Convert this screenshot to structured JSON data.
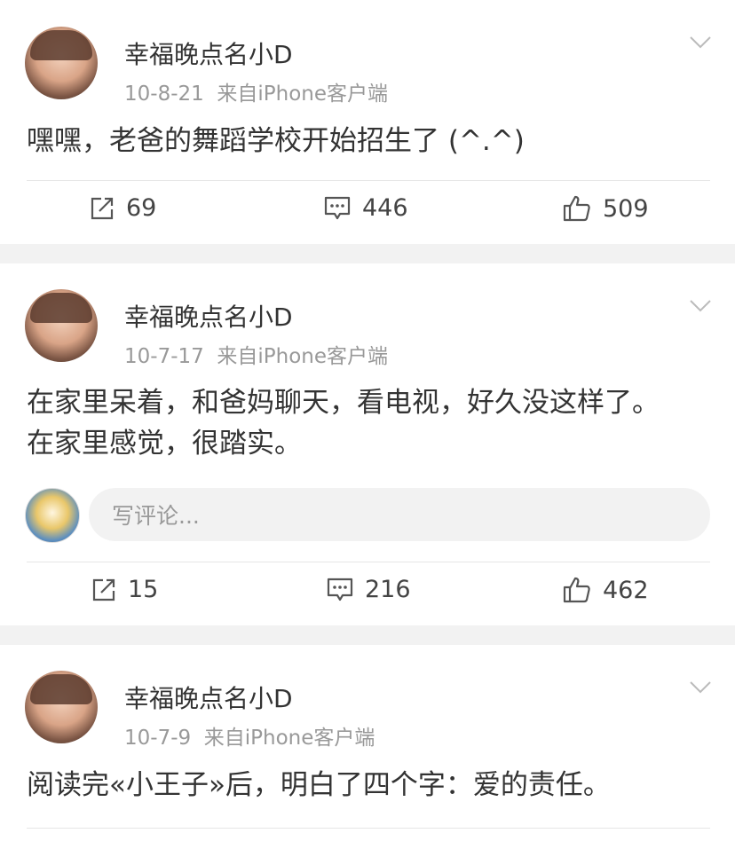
{
  "posts": [
    {
      "author": "幸福晚点名小D",
      "date": "10-8-21",
      "source": "来自iPhone客户端",
      "text_lines": [
        "嘿嘿，老爸的舞蹈学校开始招生了 (^.^)"
      ],
      "reposts": "69",
      "comments": "446",
      "likes": "509"
    },
    {
      "author": "幸福晚点名小D",
      "date": "10-7-17",
      "source": "来自iPhone客户端",
      "text_lines": [
        "在家里呆着，和爸妈聊天，看电视，好久没这样了。",
        "在家里感觉，很踏实。"
      ],
      "comment_placeholder": "写评论...",
      "reposts": "15",
      "comments": "216",
      "likes": "462"
    },
    {
      "author": "幸福晚点名小D",
      "date": "10-7-9",
      "source": "来自iPhone客户端",
      "text_lines": [
        "阅读完«小王子»后，明白了四个字：爱的责任。"
      ]
    }
  ],
  "icons": {
    "repost": "repost-icon",
    "comment": "comment-icon",
    "like": "thumbs-up-icon",
    "menu": "chevron-down-icon"
  },
  "colors": {
    "background": "#f2f2f2",
    "text": "#333333",
    "muted": "#999999"
  }
}
